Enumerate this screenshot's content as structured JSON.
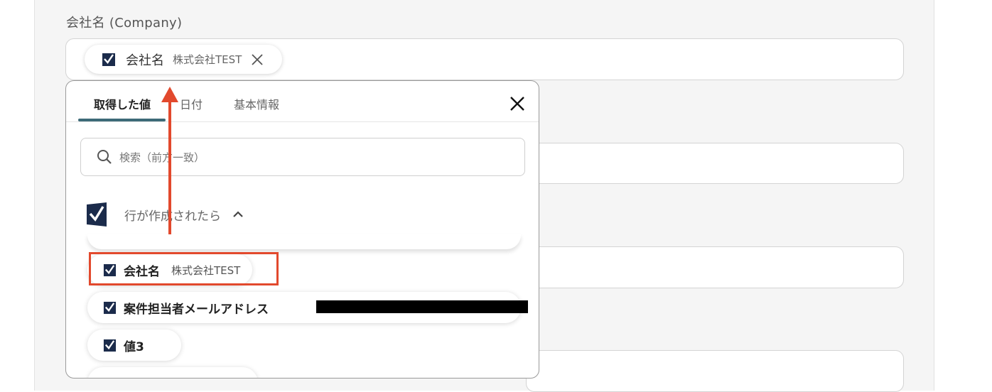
{
  "form": {
    "company_label": "会社名 (Company)"
  },
  "selected_chip": {
    "name": "会社名",
    "value": "株式会社TEST"
  },
  "dropdown": {
    "tabs": [
      {
        "label": "取得した値",
        "active": true
      },
      {
        "label": "日付",
        "active": false
      },
      {
        "label": "基本情報",
        "active": false
      }
    ],
    "search_placeholder": "検索（前方一致）",
    "group_label": "行が作成されたら",
    "items": [
      {
        "name": "会社名",
        "value": "株式会社TEST",
        "highlighted": true
      },
      {
        "name": "案件担当者メールアドレス",
        "value": "",
        "redacted": true
      },
      {
        "name": "値3",
        "value": ""
      }
    ]
  },
  "colors": {
    "accent": "#3d6a78",
    "highlight": "#e2492d",
    "logo": "#1b2b4b"
  },
  "icons": {
    "chip_logo": "smartsheet-icon",
    "chip_close": "close-icon",
    "dropdown_close": "close-icon",
    "search": "search-icon",
    "group_toggle": "chevron-up-icon"
  }
}
